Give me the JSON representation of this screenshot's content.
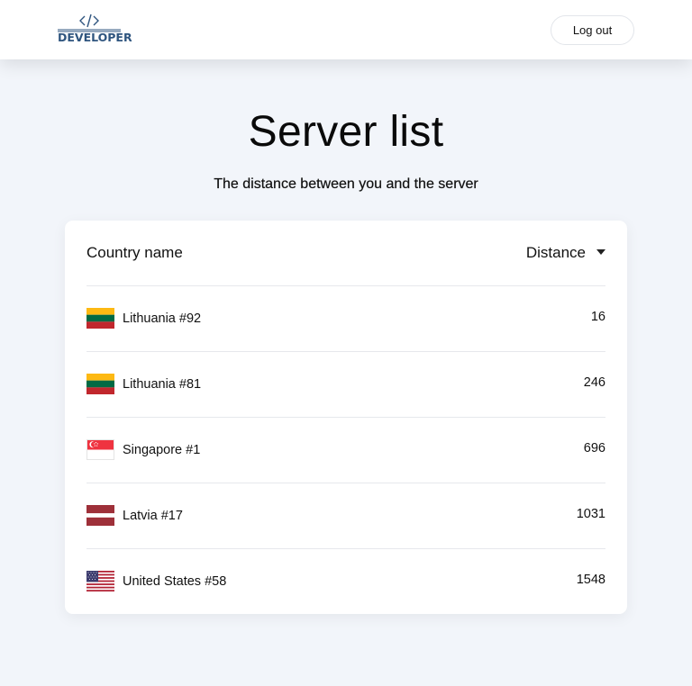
{
  "header": {
    "logo_text": "DEVELOPER",
    "logout_label": "Log out"
  },
  "page": {
    "title": "Server list",
    "subtitle": "The distance between you and the server"
  },
  "table": {
    "columns": {
      "country": "Country name",
      "distance": "Distance"
    },
    "sort_icon": "caret-down-icon",
    "rows": [
      {
        "country": "Lithuania #92",
        "distance": "16",
        "flag": "lithuania-flag-icon"
      },
      {
        "country": "Lithuania #81",
        "distance": "246",
        "flag": "lithuania-flag-icon"
      },
      {
        "country": "Singapore #1",
        "distance": "696",
        "flag": "singapore-flag-icon"
      },
      {
        "country": "Latvia #17",
        "distance": "1031",
        "flag": "latvia-flag-icon"
      },
      {
        "country": "United States #58",
        "distance": "1548",
        "flag": "united-states-flag-icon"
      }
    ]
  },
  "colors": {
    "page_background": "#f2f5fa",
    "logo_blue": "#2f557f",
    "divider": "#e6e8ec"
  }
}
